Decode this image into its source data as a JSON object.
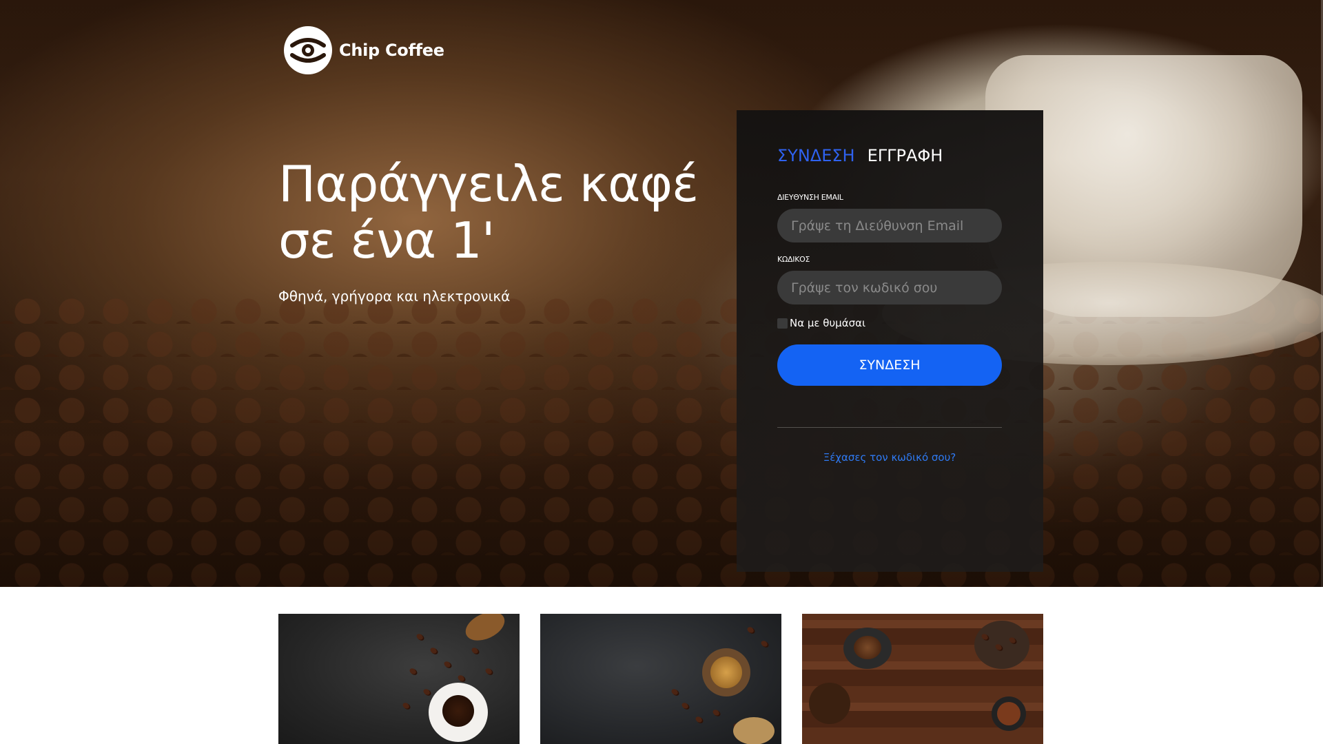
{
  "brand": {
    "name": "Chip Coffee"
  },
  "hero": {
    "headline_line1": "Παράγγειλε καφέ",
    "headline_line2": "σε ένα 1'",
    "subline": "Φθηνά, γρήγορα και ηλεκτρονικά"
  },
  "login": {
    "tabs": [
      {
        "label": "ΣΥΝΔΕΣΗ",
        "active": true
      },
      {
        "label": "ΕΓΓΡΑΦΗ",
        "active": false
      }
    ],
    "email_label": "ΔΙΕΥΘΥΝΣΗ EMAIL",
    "email_placeholder": "Γράψε τη Διεύθυνση Email",
    "password_label": "ΚΩΔΙΚΟΣ",
    "password_placeholder": "Γράψε τον κωδικό σου",
    "remember_label": "Να με θυμάσαι",
    "submit_label": "ΣΥΝΔΕΣΗ",
    "forgot_label": "Ξέχασες τον κωδικό σου?"
  },
  "colors": {
    "accent": "#1463f3",
    "active_tab": "#2f62f0",
    "link": "#2f7bf5",
    "panel_bg": "#141211"
  },
  "icons": {
    "logo": "coffee-cup-logo-icon"
  }
}
